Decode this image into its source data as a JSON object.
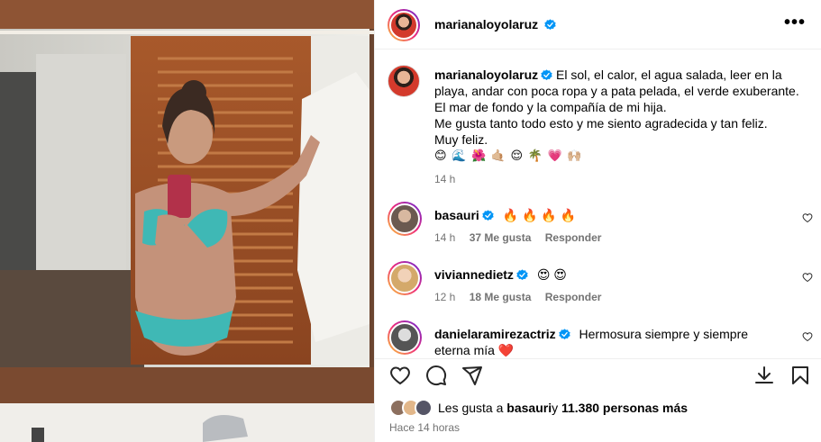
{
  "post": {
    "author": "marianaloyolaruz",
    "more_label": "•••"
  },
  "caption": {
    "author": "marianaloyolaruz",
    "lines": [
      "El sol, el calor, el agua salada, leer en la playa, andar con poca ropa y a pata pelada, el verde exuberante.",
      "El mar de fondo y la compañía de mi hija.",
      "Me gusta tanto todo esto y me siento agradecida y tan feliz.",
      "Muy feliz."
    ],
    "emojis": "😊 🌊 🌺 🤙🏼 😌 🌴 💗 🙌🏼",
    "time": "14 h"
  },
  "comments": [
    {
      "user": "basauri",
      "text": "🔥 🔥 🔥 🔥",
      "time": "14 h",
      "likes": "37 Me gusta",
      "reply": "Responder"
    },
    {
      "user": "viviannedietz",
      "text": "😍 😍",
      "time": "12 h",
      "likes": "18 Me gusta",
      "reply": "Responder"
    },
    {
      "user": "danielaramirezactriz",
      "text": "Hermosura siempre y siempre eterna mía ❤️",
      "time": "",
      "likes": "",
      "reply": ""
    }
  ],
  "likes": {
    "prefix": "Les gusta a ",
    "user": "basauri",
    "middle": " y ",
    "count": "11.380 personas más"
  },
  "ago": "Hace 14 horas",
  "icons": [
    "heart-icon",
    "comment-icon",
    "share-icon",
    "download-icon",
    "bookmark-icon",
    "verified-icon",
    "more-icon"
  ]
}
